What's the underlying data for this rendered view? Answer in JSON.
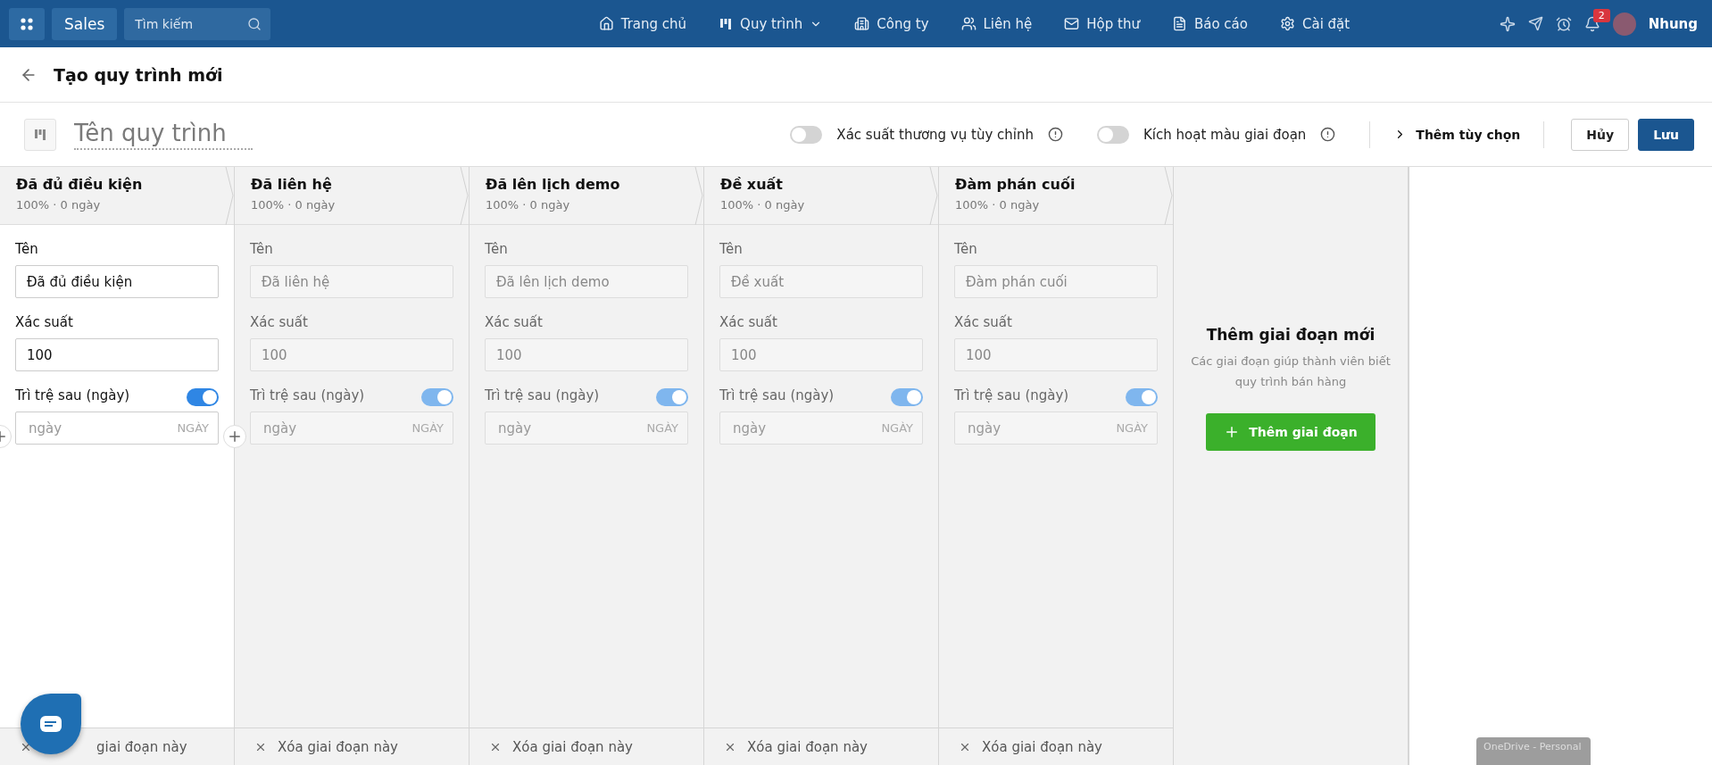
{
  "nav": {
    "app_name": "Sales",
    "search": {
      "placeholder": "Tìm kiếm"
    },
    "items": [
      {
        "label": "Trang chủ",
        "dropdown": false
      },
      {
        "label": "Quy trình",
        "dropdown": true
      },
      {
        "label": "Công ty",
        "dropdown": false
      },
      {
        "label": "Liên hệ",
        "dropdown": false
      },
      {
        "label": "Hộp thư",
        "dropdown": false
      },
      {
        "label": "Báo cáo",
        "dropdown": false
      },
      {
        "label": "Cài đặt",
        "dropdown": false
      }
    ],
    "notification_count": "2",
    "user": "Nhung"
  },
  "page_title": "Tạo quy trình mới",
  "toolbar": {
    "name_placeholder": "Tên quy trình",
    "options": [
      {
        "label": "Xác suất thương vụ tùy chỉnh",
        "on": false
      },
      {
        "label": "Kích hoạt màu giai đoạn",
        "on": false
      }
    ],
    "more": "Thêm tùy chọn",
    "cancel": "Hủy",
    "save": "Lưu"
  },
  "stages": [
    {
      "name": "Đã đủ điều kiện",
      "summary": "100% · 0 ngày",
      "active": true,
      "name_label": "Tên",
      "name_value": "Đã đủ điều kiện",
      "prob_label": "Xác suất",
      "prob_value": "100",
      "delay_label": "Trì trệ sau (ngày)",
      "delay_on": true,
      "delay_placeholder": "ngày",
      "delay_unit": "NGÀY",
      "delete": "giai đoạn này"
    },
    {
      "name": "Đã liên hệ",
      "summary": "100% · 0 ngày",
      "active": false,
      "name_label": "Tên",
      "name_value": "Đã liên hệ",
      "prob_label": "Xác suất",
      "prob_value": "100",
      "delay_label": "Trì trệ sau (ngày)",
      "delay_on": true,
      "delay_placeholder": "ngày",
      "delay_unit": "NGÀY",
      "delete": "Xóa giai đoạn này"
    },
    {
      "name": "Đã lên lịch demo",
      "summary": "100% · 0 ngày",
      "active": false,
      "name_label": "Tên",
      "name_value": "Đã lên lịch demo",
      "prob_label": "Xác suất",
      "prob_value": "100",
      "delay_label": "Trì trệ sau (ngày)",
      "delay_on": true,
      "delay_placeholder": "ngày",
      "delay_unit": "NGÀY",
      "delete": "Xóa giai đoạn này"
    },
    {
      "name": "Đề xuất",
      "summary": "100% · 0 ngày",
      "active": false,
      "name_label": "Tên",
      "name_value": "Đề xuất",
      "prob_label": "Xác suất",
      "prob_value": "100",
      "delay_label": "Trì trệ sau (ngày)",
      "delay_on": true,
      "delay_placeholder": "ngày",
      "delay_unit": "NGÀY",
      "delete": "Xóa giai đoạn này"
    },
    {
      "name": "Đàm phán cuối",
      "summary": "100% · 0 ngày",
      "active": false,
      "name_label": "Tên",
      "name_value": "Đàm phán cuối",
      "prob_label": "Xác suất",
      "prob_value": "100",
      "delay_label": "Trì trệ sau (ngày)",
      "delay_on": true,
      "delay_placeholder": "ngày",
      "delay_unit": "NGÀY",
      "delete": "Xóa giai đoạn này"
    }
  ],
  "add_stage": {
    "title": "Thêm giai đoạn mới",
    "description": "Các giai đoạn giúp thành viên biết quy trình bán hàng",
    "button": "Thêm giai đoạn"
  },
  "tooltip": {
    "text": "OneDrive - Personal"
  }
}
